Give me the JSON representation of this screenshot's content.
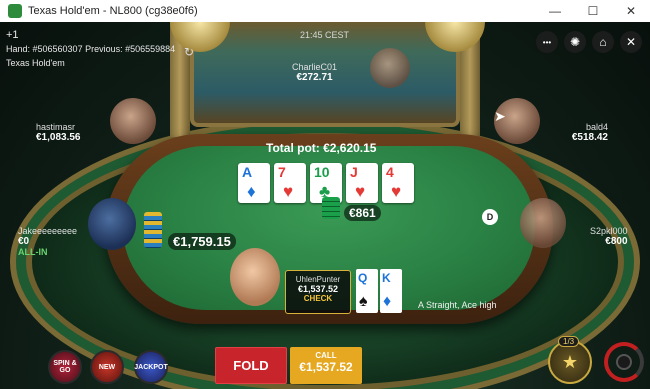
{
  "window": {
    "title": "Texas Hold'em - NL800 (cg38e0f6)",
    "minimize": "—",
    "maximize": "☐",
    "close": "✕"
  },
  "hand": {
    "plus": "+1",
    "info": "Hand: #506560307  Previous: #506559884",
    "game": "Texas Hold'em",
    "clock": "21:45 CEST"
  },
  "controls": {
    "more": "•••",
    "settings": "✺",
    "home": "⌂",
    "close": "✕"
  },
  "players": {
    "top": {
      "name": "CharlieC01",
      "stack": "€272.71"
    },
    "left": {
      "name": "hastimasr",
      "stack": "€1,083.56"
    },
    "right": {
      "name": "bald4",
      "stack": "€518.42"
    },
    "lower_left": {
      "name": "Jakeeeeeeeee",
      "stack": "€0",
      "status": "ALL-IN"
    },
    "lower_right": {
      "name": "S2pkl000",
      "stack": "€800"
    },
    "hero": {
      "name": "UhlenPunter",
      "stack": "€1,537.52",
      "action": "CHECK"
    }
  },
  "pot": {
    "label": "Total pot: €2,620.15"
  },
  "board": [
    {
      "rank": "A",
      "suit": "♦",
      "color": "blue"
    },
    {
      "rank": "7",
      "suit": "♥",
      "color": "red"
    },
    {
      "rank": "10",
      "suit": "♣",
      "color": "green"
    },
    {
      "rank": "J",
      "suit": "♥",
      "color": "red"
    },
    {
      "rank": "4",
      "suit": "♥",
      "color": "red"
    }
  ],
  "hole_cards": [
    {
      "rank": "Q",
      "suit": "♠",
      "color": "#1e73d8"
    },
    {
      "rank": "K",
      "suit": "♦",
      "color": "#1e73d8"
    }
  ],
  "bets": {
    "center": "€861",
    "left": "€1,759.15"
  },
  "dealer_button": "D",
  "hand_description": "A Straight, Ace high",
  "actions": {
    "fold": "FOLD",
    "call_label": "CALL",
    "call_amount": "€1,537.52"
  },
  "promos": [
    "SPIN & GO",
    "NEW",
    "JACKPOT"
  ],
  "mission_count": "1/3",
  "colors": {
    "fold": "#c8242b",
    "call": "#e5a820",
    "felt": "#2a8144",
    "highlight": "#d7b23a"
  }
}
